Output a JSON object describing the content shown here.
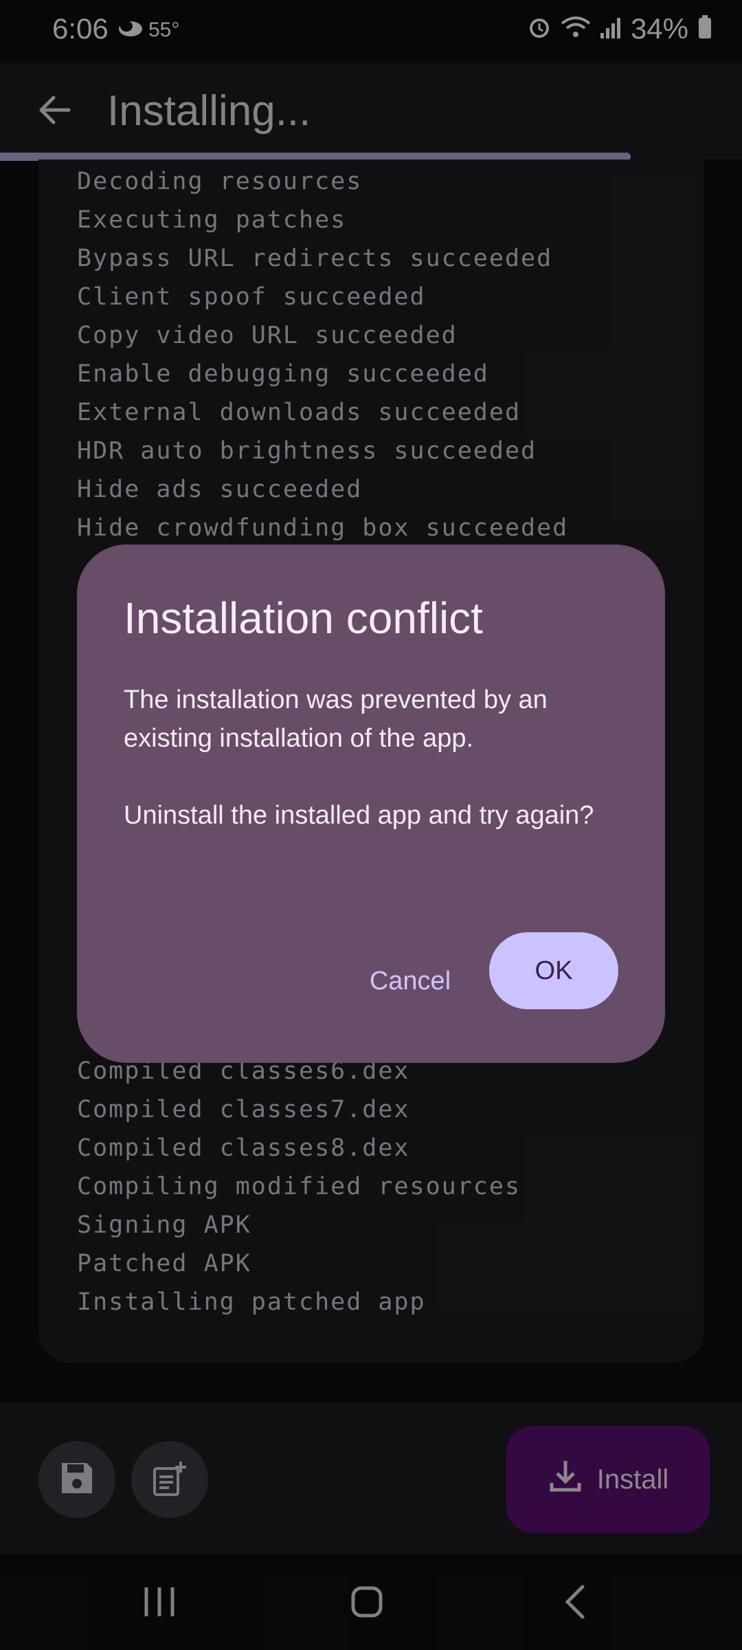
{
  "status_bar": {
    "time": "6:06",
    "temperature": "55°",
    "battery": "34%",
    "icons": [
      "weather-cloud-icon",
      "alarm-icon",
      "wifi-icon",
      "signal-icon",
      "battery-icon"
    ]
  },
  "app_bar": {
    "title": "Installing..."
  },
  "progress": 0.85,
  "log": {
    "top_lines": [
      "Decoding resources",
      "Executing patches",
      "Bypass URL redirects succeeded",
      "Client spoof succeeded",
      "Copy video URL succeeded",
      "Enable debugging succeeded",
      "External downloads succeeded",
      "HDR auto brightness succeeded",
      "Hide ads succeeded",
      "Hide crowdfunding box succeeded"
    ],
    "bottom_lines": [
      "Compiled classes6.dex",
      "Compiled classes7.dex",
      "Compiled classes8.dex",
      "Compiling modified resources",
      "Signing APK",
      "Patched APK",
      "Installing patched app"
    ]
  },
  "bottom": {
    "install_label": "Install"
  },
  "dialog": {
    "title": "Installation conflict",
    "message_1": "The installation was prevented by an existing installation of the app.",
    "message_2": "Uninstall the installed app and try again?",
    "cancel_label": "Cancel",
    "ok_label": "OK"
  },
  "colors": {
    "dialog_bg": "#674d67",
    "ok_bg": "#cbc3ff",
    "install_bg": "#5a0f6e",
    "accent_text": "#d3c2ff"
  }
}
